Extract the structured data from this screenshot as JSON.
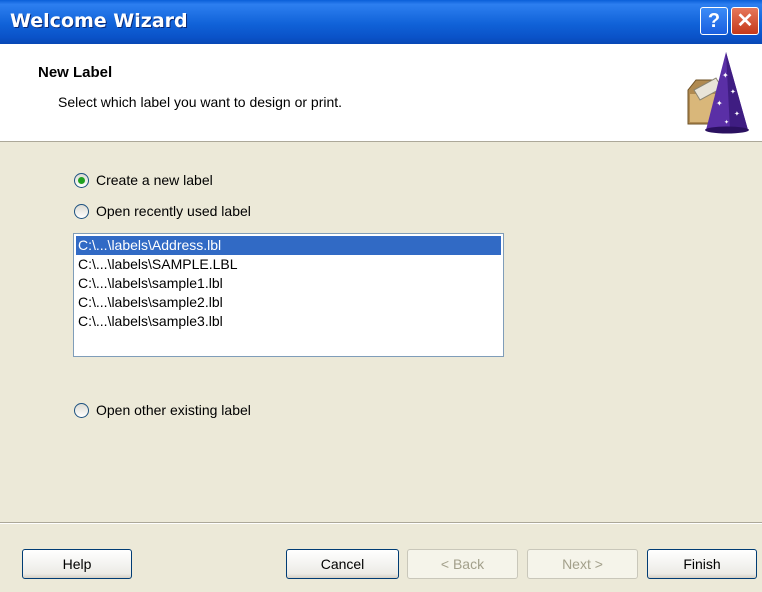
{
  "window": {
    "title": "Welcome Wizard",
    "help_glyph": "?",
    "close_glyph": "✕"
  },
  "header": {
    "title": "New Label",
    "subtitle": "Select which label you want to design or print.",
    "icon": "wizard-hat-icon"
  },
  "options": {
    "create_new": {
      "label": "Create a new label",
      "checked": true
    },
    "open_recent": {
      "label": "Open recently used label",
      "checked": false
    },
    "open_other": {
      "label": "Open other existing label",
      "checked": false
    }
  },
  "recent_files": {
    "items": [
      "C:\\...\\labels\\Address.lbl",
      "C:\\...\\labels\\SAMPLE.LBL",
      "C:\\...\\labels\\sample1.lbl",
      "C:\\...\\labels\\sample2.lbl",
      "C:\\...\\labels\\sample3.lbl"
    ],
    "selected_index": 0
  },
  "buttons": {
    "help": "Help",
    "cancel": "Cancel",
    "back": "< Back",
    "next": "Next >",
    "finish": "Finish"
  }
}
